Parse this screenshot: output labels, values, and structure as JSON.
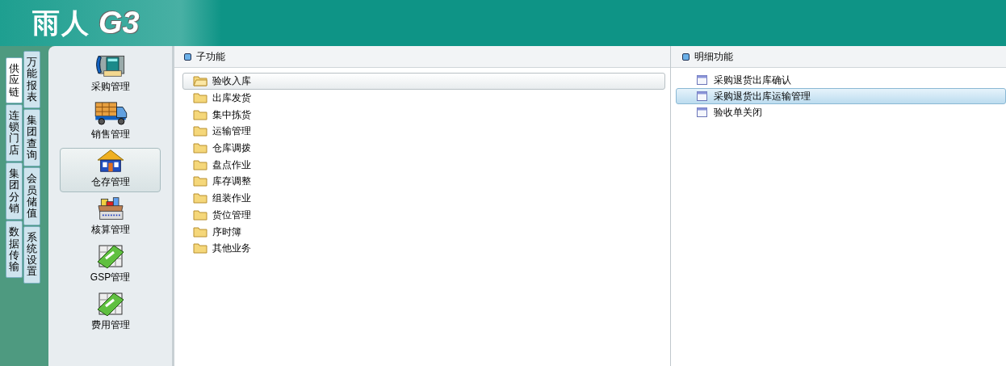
{
  "header": {
    "logo_text": "雨人",
    "logo_mark": "G3"
  },
  "tabs_primary": [
    {
      "label": "供应链",
      "selected": true
    },
    {
      "label": "连锁门店",
      "selected": false
    },
    {
      "label": "集团分销",
      "selected": false
    },
    {
      "label": "数据传输",
      "selected": false
    }
  ],
  "tabs_secondary": [
    {
      "label": "万能报表",
      "selected": false
    },
    {
      "label": "集团查询",
      "selected": false
    },
    {
      "label": "会员储值",
      "selected": false
    },
    {
      "label": "系统设置",
      "selected": false
    }
  ],
  "modules": [
    {
      "label": "采购管理",
      "kind": "phone",
      "selected": false
    },
    {
      "label": "销售管理",
      "kind": "truck",
      "selected": false
    },
    {
      "label": "仓存管理",
      "kind": "house",
      "selected": true
    },
    {
      "label": "核算管理",
      "kind": "box",
      "selected": false
    },
    {
      "label": "GSP管理",
      "kind": "money",
      "selected": false
    },
    {
      "label": "费用管理",
      "kind": "money",
      "selected": false
    }
  ],
  "sub_functions": {
    "title": "子功能",
    "items": [
      {
        "label": "验收入库",
        "selected": true
      },
      {
        "label": "出库发货",
        "selected": false
      },
      {
        "label": "集中拣货",
        "selected": false
      },
      {
        "label": "运输管理",
        "selected": false
      },
      {
        "label": "仓库调拨",
        "selected": false
      },
      {
        "label": "盘点作业",
        "selected": false
      },
      {
        "label": "库存调整",
        "selected": false
      },
      {
        "label": "组装作业",
        "selected": false
      },
      {
        "label": "货位管理",
        "selected": false
      },
      {
        "label": "序时簿",
        "selected": false
      },
      {
        "label": "其他业务",
        "selected": false
      }
    ]
  },
  "detail_functions": {
    "title": "明细功能",
    "items": [
      {
        "label": "采购退货出库确认",
        "selected": false
      },
      {
        "label": "采购退货出库运输管理",
        "selected": true
      },
      {
        "label": "验收单关闭",
        "selected": false
      }
    ]
  }
}
